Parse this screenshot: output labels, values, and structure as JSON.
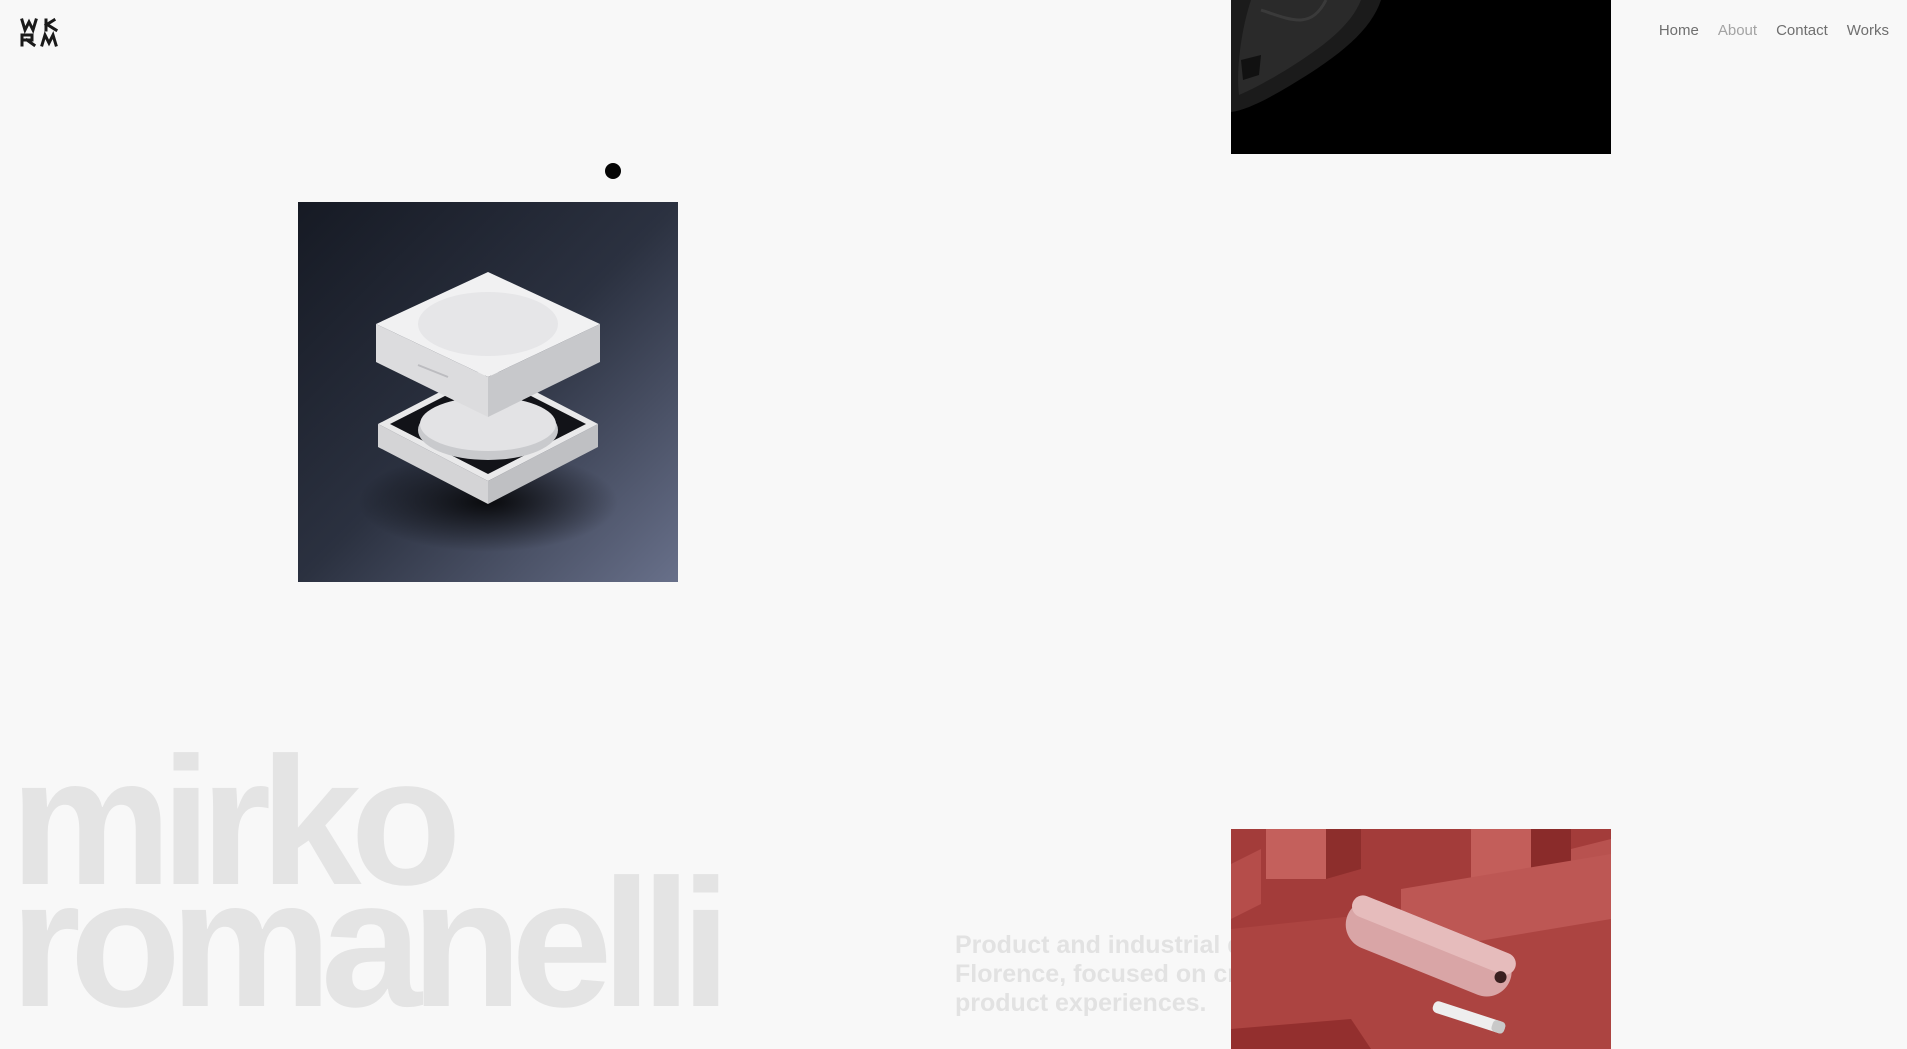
{
  "brand": {
    "logo_text": "MKRM"
  },
  "nav": {
    "items": [
      {
        "label": "Home",
        "active": false
      },
      {
        "label": "About",
        "active": true
      },
      {
        "label": "Contact",
        "active": false
      },
      {
        "label": "Works",
        "active": false
      }
    ]
  },
  "hero": {
    "first_name": "mirko",
    "last_name": "romanelli"
  },
  "intro": {
    "line1": "Product and industrial de",
    "line2": "Florence, focused on cre",
    "line3": "product experiences."
  },
  "colors": {
    "background": "#f8f8f8",
    "nav_text": "#6f6f6f",
    "nav_active": "#a3a3a3",
    "hero_text": "#e4e4e4",
    "cursor": "#050505"
  }
}
